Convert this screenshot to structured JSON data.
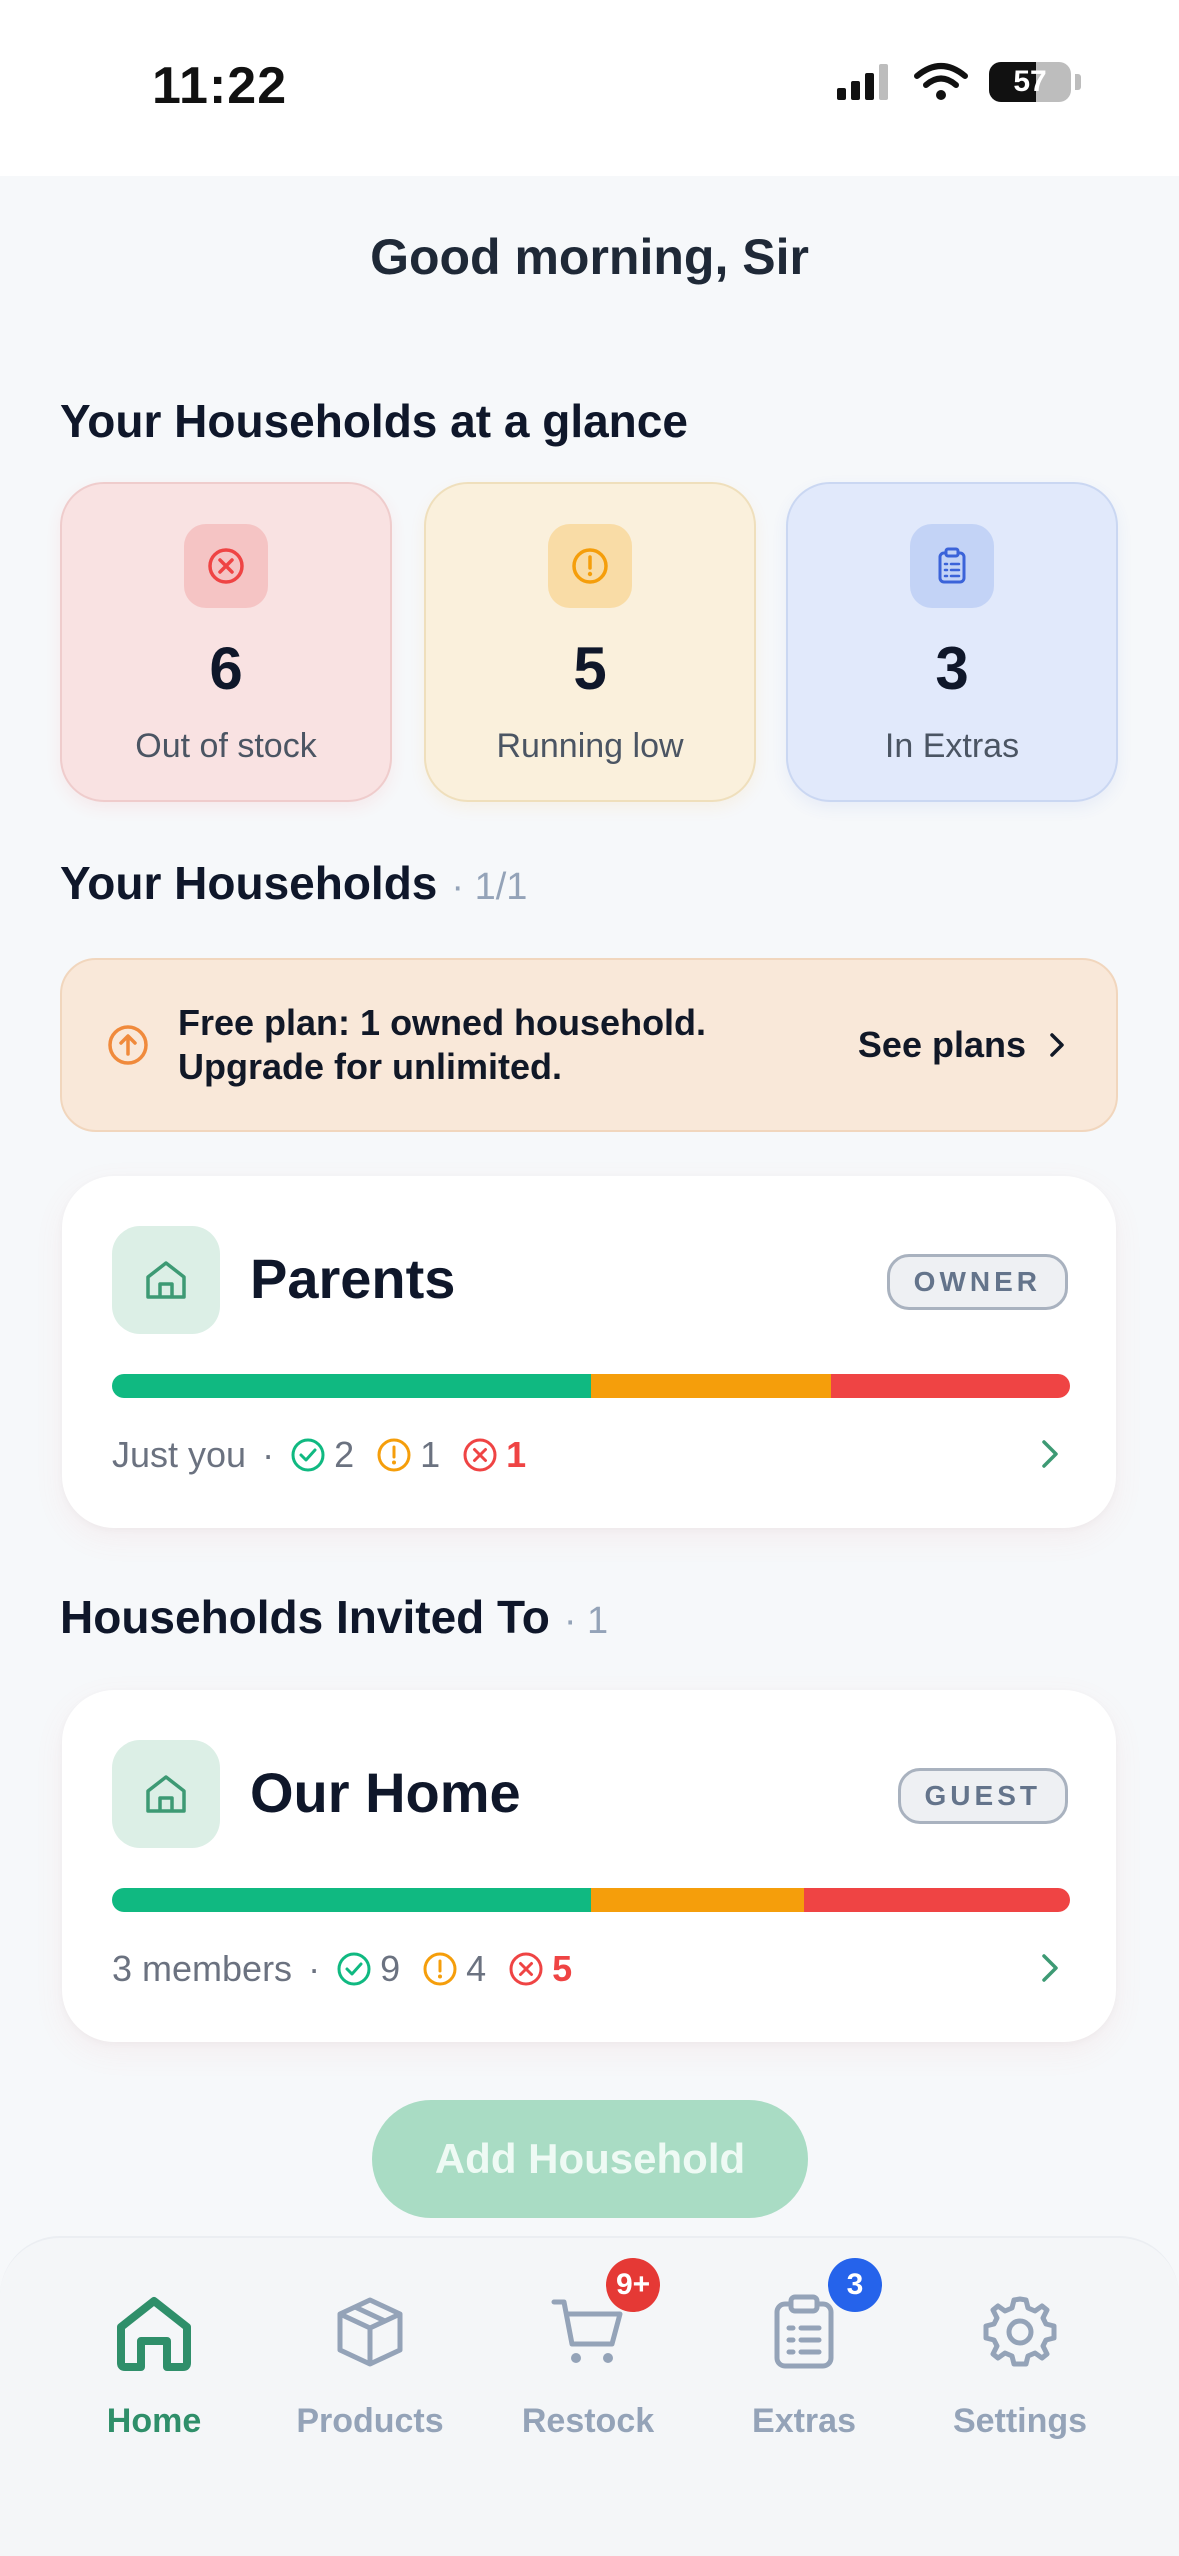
{
  "status_bar": {
    "time": "11:22",
    "battery": "57"
  },
  "greeting": "Good morning, Sir",
  "glance": {
    "title": "Your Households at a glance",
    "cards": [
      {
        "value": "6",
        "label": "Out of stock",
        "icon": "x-circle-icon",
        "color": "#ef4444"
      },
      {
        "value": "5",
        "label": "Running low",
        "icon": "alert-circle-icon",
        "color": "#f59e0b"
      },
      {
        "value": "3",
        "label": "In Extras",
        "icon": "clipboard-icon",
        "color": "#3b63d9"
      }
    ]
  },
  "households": {
    "title": "Your Households",
    "count": "· 1/1",
    "banner": {
      "line1": "Free plan: 1 owned household.",
      "line2": "Upgrade for unlimited.",
      "link": "See plans"
    },
    "items": [
      {
        "name": "Parents",
        "role": "OWNER",
        "members": "Just you",
        "ok": "2",
        "low": "1",
        "out": "1",
        "bar": [
          0.5,
          0.25,
          0.25
        ]
      }
    ]
  },
  "invited": {
    "title": "Households Invited To",
    "count": "· 1",
    "items": [
      {
        "name": "Our Home",
        "role": "GUEST",
        "members": "3 members",
        "ok": "9",
        "low": "4",
        "out": "5",
        "bar": [
          0.5,
          0.222,
          0.278
        ]
      }
    ]
  },
  "add_button": "Add Household",
  "tabs": [
    {
      "label": "Home",
      "icon": "home-icon",
      "active": true
    },
    {
      "label": "Products",
      "icon": "box-icon"
    },
    {
      "label": "Restock",
      "icon": "cart-icon",
      "badge": "9+"
    },
    {
      "label": "Extras",
      "icon": "clipboard-icon",
      "badge": "3"
    },
    {
      "label": "Settings",
      "icon": "gear-icon"
    }
  ],
  "colors": {
    "accent": "#2f8f6a",
    "ok": "#10b981",
    "low": "#f59e0b",
    "out": "#ef4444",
    "badge_red": "#e53935",
    "badge_blue": "#2563eb"
  }
}
